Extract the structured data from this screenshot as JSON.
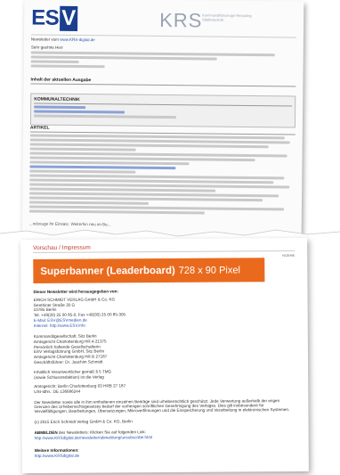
{
  "back_page": {
    "logo_esv": "ES",
    "logo_esv_v": "V",
    "logo_krs": "KRS",
    "logo_krs_sub": "Kommunalfahrzeuge Recycling Städtetechnik",
    "newsletter_label": "Newsletter vom",
    "newsletter_link": "www.KRS-digital.de",
    "greeting": "Sehr geehrte Herr",
    "section_current": "Inhalt der aktuellen Ausgabe",
    "section_kommunal": "KOMMUNALTECHNIK",
    "section_articles": "ARTIKEL",
    "cut_text": "...ndzeuge ihr Einsatz. Weiterhin neu im Be..."
  },
  "front_page": {
    "preview_title": "Vorschau / Impressum",
    "page_number": "HOEHE",
    "banner_bold": "Superbanner (Leaderboard)",
    "banner_size": "728 x 90 Pixel",
    "publisher_heading": "Dieser Newsletter wird herausgegeben von:",
    "publisher_lines": [
      "ERICH SCHMIDT VERLAG GmbH & Co. KG",
      "Genthiner Straße 30 G",
      "10785 Berlin",
      "Tel. +49(30) 25 00 85-0, Fax +49(30) 25 00 85-305",
      "E-Mail: ESV@ESVmedien.de",
      "Internet: http://www.ESV.info"
    ],
    "company_lines": [
      "Kommanditgesellschaft, Sitz Berlin",
      "Amtsgericht Charlottenburg HR A 21375",
      "Persönlich haftende Gesellschafterin",
      "ESV Verlagsführung GmbH, Sitz Berlin",
      "Amtsgericht Charlottenburg HR B 27187",
      "Geschäftsführer: Dr. Joachim Schmidt"
    ],
    "responsible_lines": [
      "Inhaltlich Verantwortlicher gemäß § 5 TMG",
      "(sowie Schlussredaktion) ist die Verlag"
    ],
    "registry_lines": [
      "Amtsgericht: Berlin Charlottenburg 03 HRB 27 187",
      "USt-IdNr.: DE 136686244"
    ],
    "copyright_paragraph": "Der Newsletter sowie alle in ihm enthaltenen einzelnen Beiträge sind urheberrechtlich geschützt. Jede Verwertung außerhalb der engen Grenzen des Urheberrechtsgesetzes bedarf der vorherigen schriftlichen Genehmigung des Verlages. Dies gilt insbesondere für Vervielfältigungen, Bearbeitungen, Übersetzungen, Mikroverfilmungen und die Einspeicherung und Verarbeitung in elektronischen Systemen.",
    "copyright_line": "(c) 2015 Erich Schmidt Verlag GmbH & Co. KG, Berlin",
    "unsubscribe_bold": "ABMELDEN",
    "unsubscribe_text": "des Newsletters: Klicken Sie auf folgenden Link:",
    "unsubscribe_link": "http://www.KRSdigital.de/newsletter/abmeldung/unsubscribe.html",
    "more_info_heading": "Weitere Informationen:",
    "more_info_link": "http://www.KRSdigital.de"
  }
}
